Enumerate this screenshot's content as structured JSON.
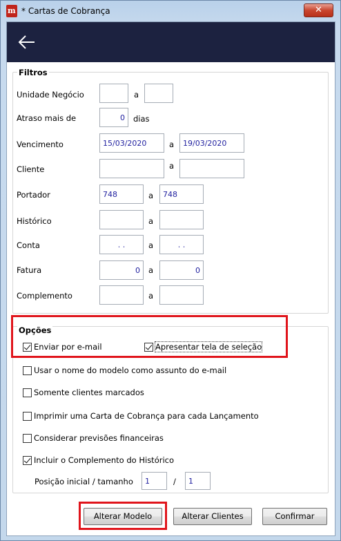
{
  "window": {
    "title": "* Cartas de Cobrança",
    "close_glyph": "✕",
    "app_icon_glyph": "m"
  },
  "filtros": {
    "title": "Filtros",
    "rows": [
      {
        "label": "Unidade Negócio",
        "sep": "a",
        "from": "",
        "to": ""
      },
      {
        "label": "Atraso mais de",
        "value": "0",
        "suffix": "dias"
      },
      {
        "label": "Vencimento",
        "sep": "a",
        "from": "15/03/2020",
        "to": "19/03/2020"
      },
      {
        "label": "Cliente",
        "sep": "a",
        "from": "",
        "to": ""
      },
      {
        "label": "Portador",
        "sep": "a",
        "from": "748",
        "to": "748"
      },
      {
        "label": "Histórico",
        "sep": "a",
        "from": "",
        "to": ""
      },
      {
        "label": "Conta",
        "sep": "a",
        "from": ". .",
        "to": ". ."
      },
      {
        "label": "Fatura",
        "sep": "a",
        "from": "0",
        "to": "0"
      },
      {
        "label": "Complemento",
        "sep": "a",
        "from": "",
        "to": ""
      }
    ]
  },
  "opcoes": {
    "title": "Opções",
    "checkboxes": [
      {
        "label": "Enviar por e-mail",
        "checked": true
      },
      {
        "label": "Apresentar tela de seleção",
        "checked": true
      },
      {
        "label": "Usar o nome do modelo como assunto do e-mail",
        "checked": false
      },
      {
        "label": "Somente clientes marcados",
        "checked": false
      },
      {
        "label": "Imprimir uma Carta de Cobrança para cada Lançamento",
        "checked": false
      },
      {
        "label": "Considerar previsões financeiras",
        "checked": false
      },
      {
        "label": "Incluir o Complemento do Histórico",
        "checked": true
      }
    ],
    "posicao": {
      "label": "Posição inicial / tamanho",
      "inicial": "1",
      "sep": "/",
      "tamanho": "1"
    }
  },
  "buttons": {
    "alterar_modelo": "Alterar Modelo",
    "alterar_clientes": "Alterar Clientes",
    "confirmar": "Confirmar"
  },
  "highlight_color": "#e0141b",
  "navbar_color": "#1c2240"
}
